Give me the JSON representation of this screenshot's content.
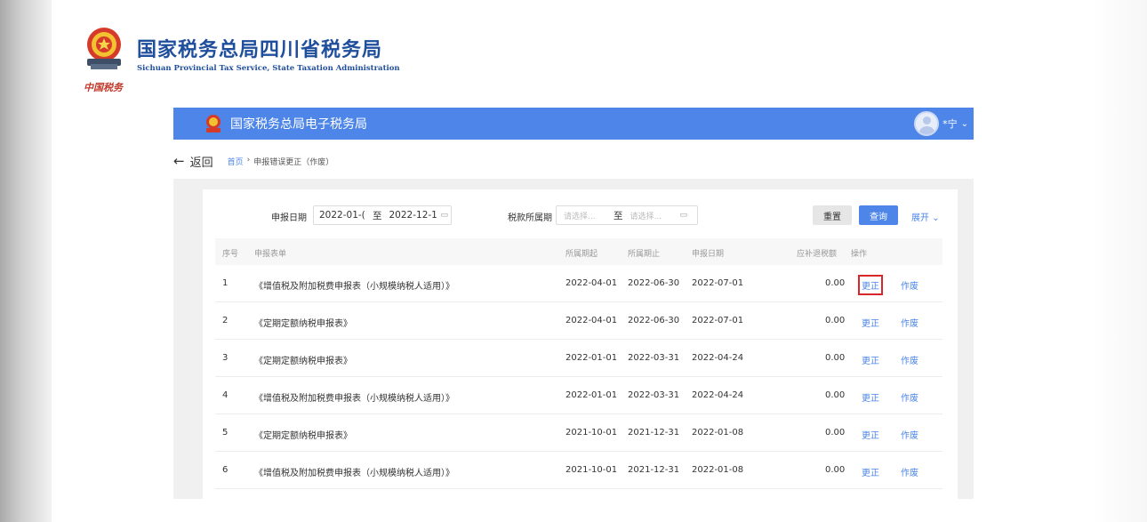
{
  "branding": {
    "title_cn": "国家税务总局四川省税务局",
    "title_en": "Sichuan Provincial Tax Service, State Taxation Administration",
    "seal_text": "中国税务"
  },
  "app": {
    "title": "国家税务总局电子税务局",
    "user_name": "*宁"
  },
  "nav": {
    "back_label": "返回",
    "breadcrumb_home": "首页",
    "breadcrumb_sep": "›",
    "breadcrumb_current": "申报错误更正（作废）"
  },
  "filters": {
    "declare_date_label": "申报日期",
    "date_from": "2022-01-(",
    "date_to": "2022-12-1",
    "range_sep": "至",
    "period_label": "税款所属期",
    "period_from_placeholder": "请选择...",
    "period_to_placeholder": "请选择...",
    "reset_label": "重置",
    "query_label": "查询",
    "expand_label": "展开"
  },
  "table": {
    "headers": {
      "index": "序号",
      "form": "申报表单",
      "period_start": "所属期起",
      "period_end": "所属期止",
      "declare_date": "申报日期",
      "amount": "应补退税额",
      "actions": "操作"
    },
    "rows": [
      {
        "index": "1",
        "form": "《增值税及附加税费申报表（小规模纳税人适用）》",
        "period_start": "2022-04-01",
        "period_end": "2022-06-30",
        "declare_date": "2022-07-01",
        "amount": "0.00",
        "correct": "更正",
        "void": "作废"
      },
      {
        "index": "2",
        "form": "《定期定额纳税申报表》",
        "period_start": "2022-04-01",
        "period_end": "2022-06-30",
        "declare_date": "2022-07-01",
        "amount": "0.00",
        "correct": "更正",
        "void": "作废"
      },
      {
        "index": "3",
        "form": "《定期定额纳税申报表》",
        "period_start": "2022-01-01",
        "period_end": "2022-03-31",
        "declare_date": "2022-04-24",
        "amount": "0.00",
        "correct": "更正",
        "void": "作废"
      },
      {
        "index": "4",
        "form": "《增值税及附加税费申报表（小规模纳税人适用）》",
        "period_start": "2022-01-01",
        "period_end": "2022-03-31",
        "declare_date": "2022-04-24",
        "amount": "0.00",
        "correct": "更正",
        "void": "作废"
      },
      {
        "index": "5",
        "form": "《定期定额纳税申报表》",
        "period_start": "2021-10-01",
        "period_end": "2021-12-31",
        "declare_date": "2022-01-08",
        "amount": "0.00",
        "correct": "更正",
        "void": "作废"
      },
      {
        "index": "6",
        "form": "《增值税及附加税费申报表（小规模纳税人适用）》",
        "period_start": "2021-10-01",
        "period_end": "2021-12-31",
        "declare_date": "2022-01-08",
        "amount": "0.00",
        "correct": "更正",
        "void": "作废"
      }
    ]
  },
  "colors": {
    "brand_blue": "#1f4f9c",
    "topbar_blue": "#4d86e8",
    "link_blue": "#4d86e8",
    "highlight_red": "#d9262b"
  },
  "icons": {
    "emblem": "tax-emblem-icon",
    "calendar": "calendar-icon",
    "back": "back-arrow-icon",
    "caret": "chevron-down-icon"
  }
}
